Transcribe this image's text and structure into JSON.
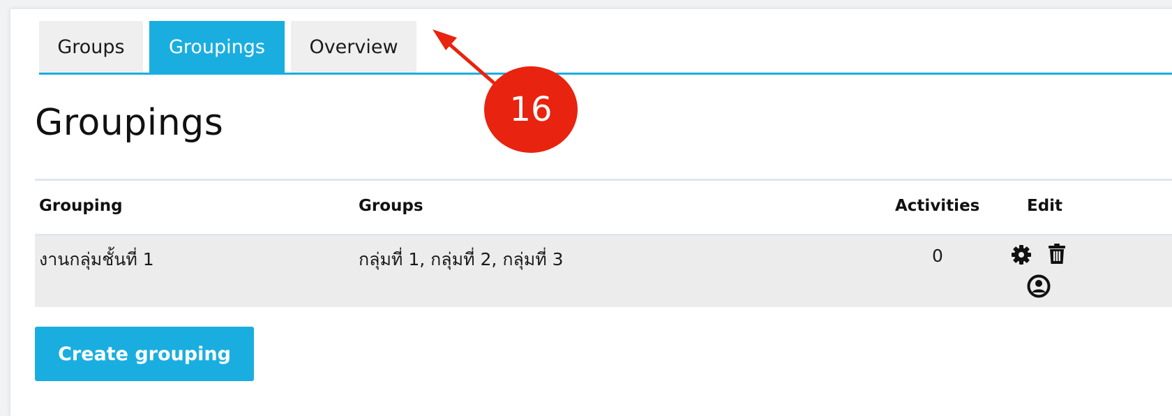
{
  "tabs": [
    {
      "label": "Groups",
      "active": false
    },
    {
      "label": "Groupings",
      "active": true
    },
    {
      "label": "Overview",
      "active": false
    }
  ],
  "page": {
    "title": "Groupings"
  },
  "table": {
    "columns": [
      "Grouping",
      "Groups",
      "Activities",
      "Edit"
    ],
    "rows": [
      {
        "grouping": "งานกลุ่มชั้นที่ 1",
        "groups": "กลุ่มที่ 1, กลุ่มที่ 2, กลุ่มที่ 3",
        "activities": "0",
        "edit_icons": [
          "gear-icon",
          "trash-icon",
          "user-circle-icon"
        ]
      }
    ]
  },
  "actions": {
    "create_label": "Create grouping"
  },
  "annotation": {
    "number": "16"
  },
  "colors": {
    "accent": "#1aaee0",
    "annotation": "#e8230f",
    "row_bg": "#ececec",
    "tab_bg": "#efefef"
  }
}
